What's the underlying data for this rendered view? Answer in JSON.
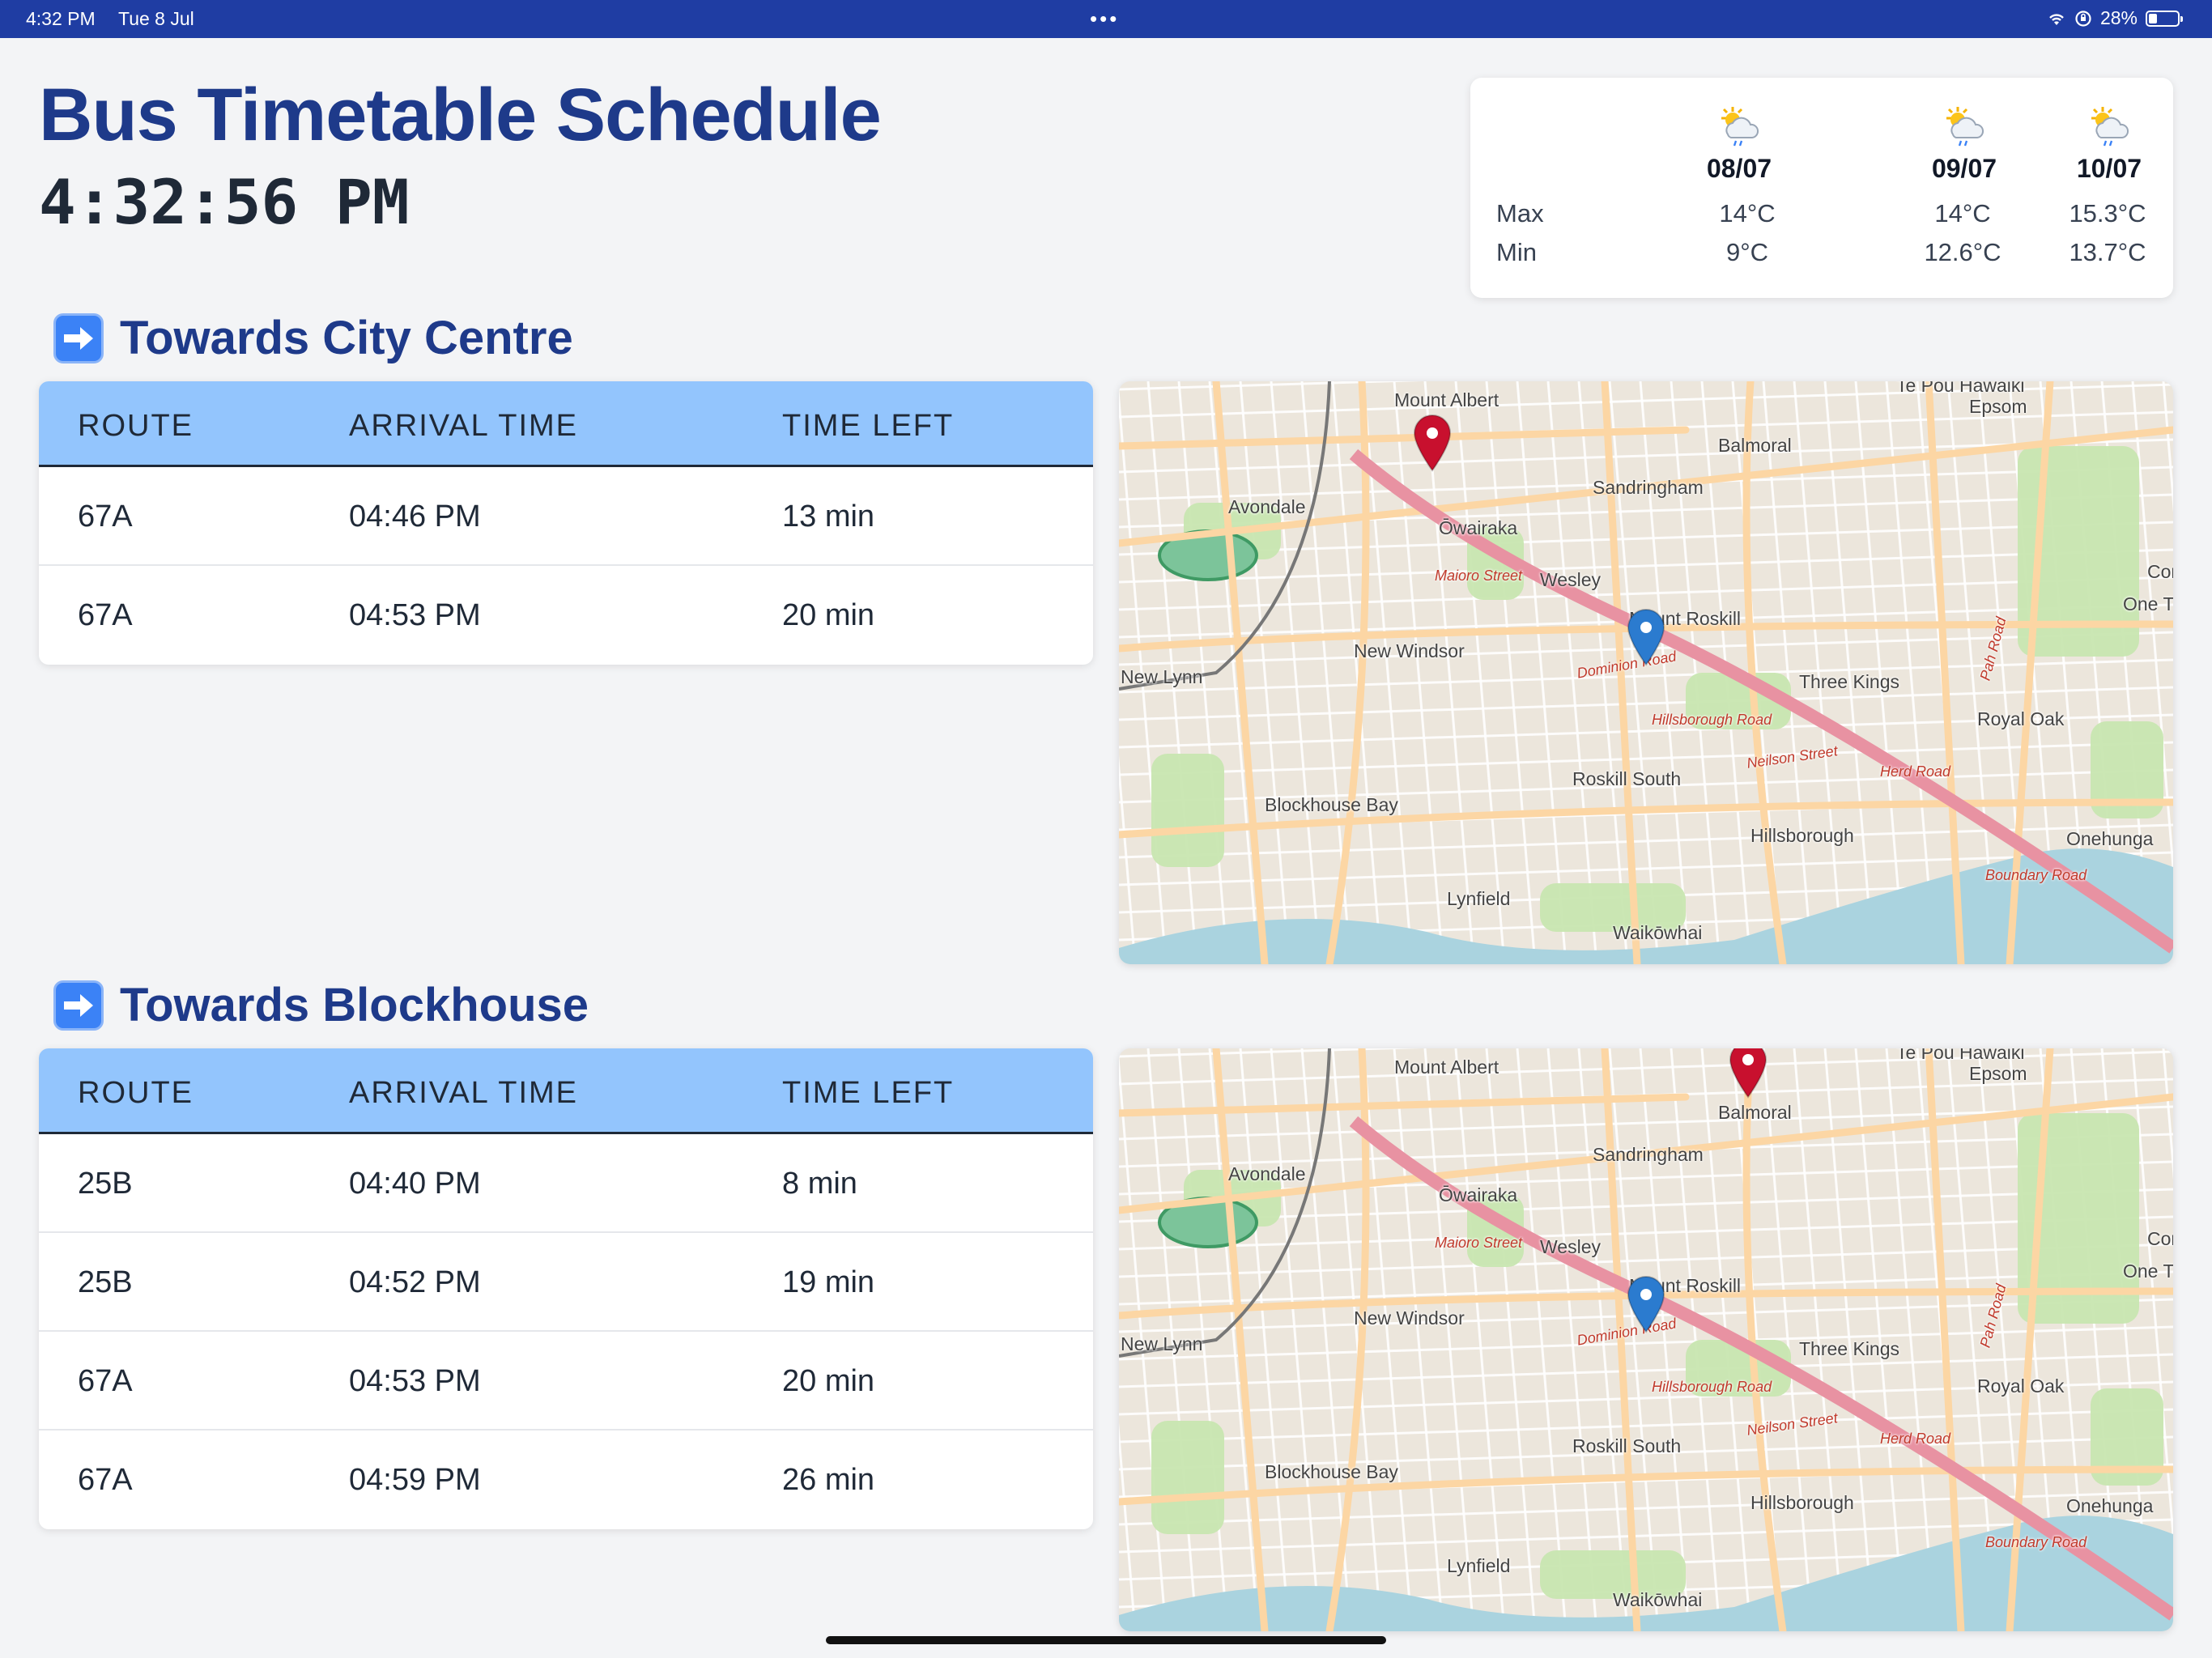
{
  "status_bar": {
    "time": "4:32 PM",
    "date": "Tue 8 Jul",
    "battery": "28%",
    "battery_level": 0.28
  },
  "header": {
    "title": "Bus Timetable Schedule",
    "clock": "4:32:56 PM"
  },
  "weather": {
    "max_label": "Max",
    "min_label": "Min",
    "icon": "sun-behind-rain-cloud-icon",
    "days": [
      {
        "date": "08/07",
        "max": "14°C",
        "min": "9°C"
      },
      {
        "date": "09/07",
        "max": "14°C",
        "min": "12.6°C"
      },
      {
        "date": "10/07",
        "max": "15.3°C",
        "min": "13.7°C"
      }
    ]
  },
  "sections": [
    {
      "title": "Towards City Centre",
      "icon": "right-arrow-icon",
      "headers": [
        "ROUTE",
        "ARRIVAL TIME",
        "TIME LEFT"
      ],
      "rows": [
        {
          "route": "67A",
          "arrival": "04:46 PM",
          "left": "13 min"
        },
        {
          "route": "67A",
          "arrival": "04:53 PM",
          "left": "20 min"
        }
      ]
    },
    {
      "title": "Towards Blockhouse",
      "icon": "right-arrow-icon",
      "headers": [
        "ROUTE",
        "ARRIVAL TIME",
        "TIME LEFT"
      ],
      "rows": [
        {
          "route": "25B",
          "arrival": "04:40 PM",
          "left": "8 min"
        },
        {
          "route": "25B",
          "arrival": "04:52 PM",
          "left": "19 min"
        },
        {
          "route": "67A",
          "arrival": "04:53 PM",
          "left": "20 min"
        },
        {
          "route": "67A",
          "arrival": "04:59 PM",
          "left": "26 min"
        }
      ]
    }
  ],
  "map": {
    "places": [
      "Mount Albert",
      "Te Pou Hawaiki",
      "Epsom",
      "Balmoral",
      "Sandringham",
      "Avondale",
      "Ōwairaka",
      "Wesley",
      "Mount Roskill",
      "New Windsor",
      "Three Kings",
      "Royal Oak",
      "Roskill South",
      "Blockhouse Bay",
      "Hillsborough",
      "Onehunga",
      "Lynfield",
      "Waikōwhai",
      "New Lynn",
      "Cornwall Park",
      "One Tree"
    ],
    "roads": [
      "Maioro Street",
      "Dominion Road",
      "Hillsborough Road",
      "Neilson Street",
      "Boundary Road",
      "Herd Road",
      "Pah Road"
    ],
    "colors": {
      "land": "#ece6dc",
      "park": "#c8e6b0",
      "water": "#aad3df",
      "motorway": "#e892a2",
      "major_road": "#fcd6a4"
    }
  }
}
